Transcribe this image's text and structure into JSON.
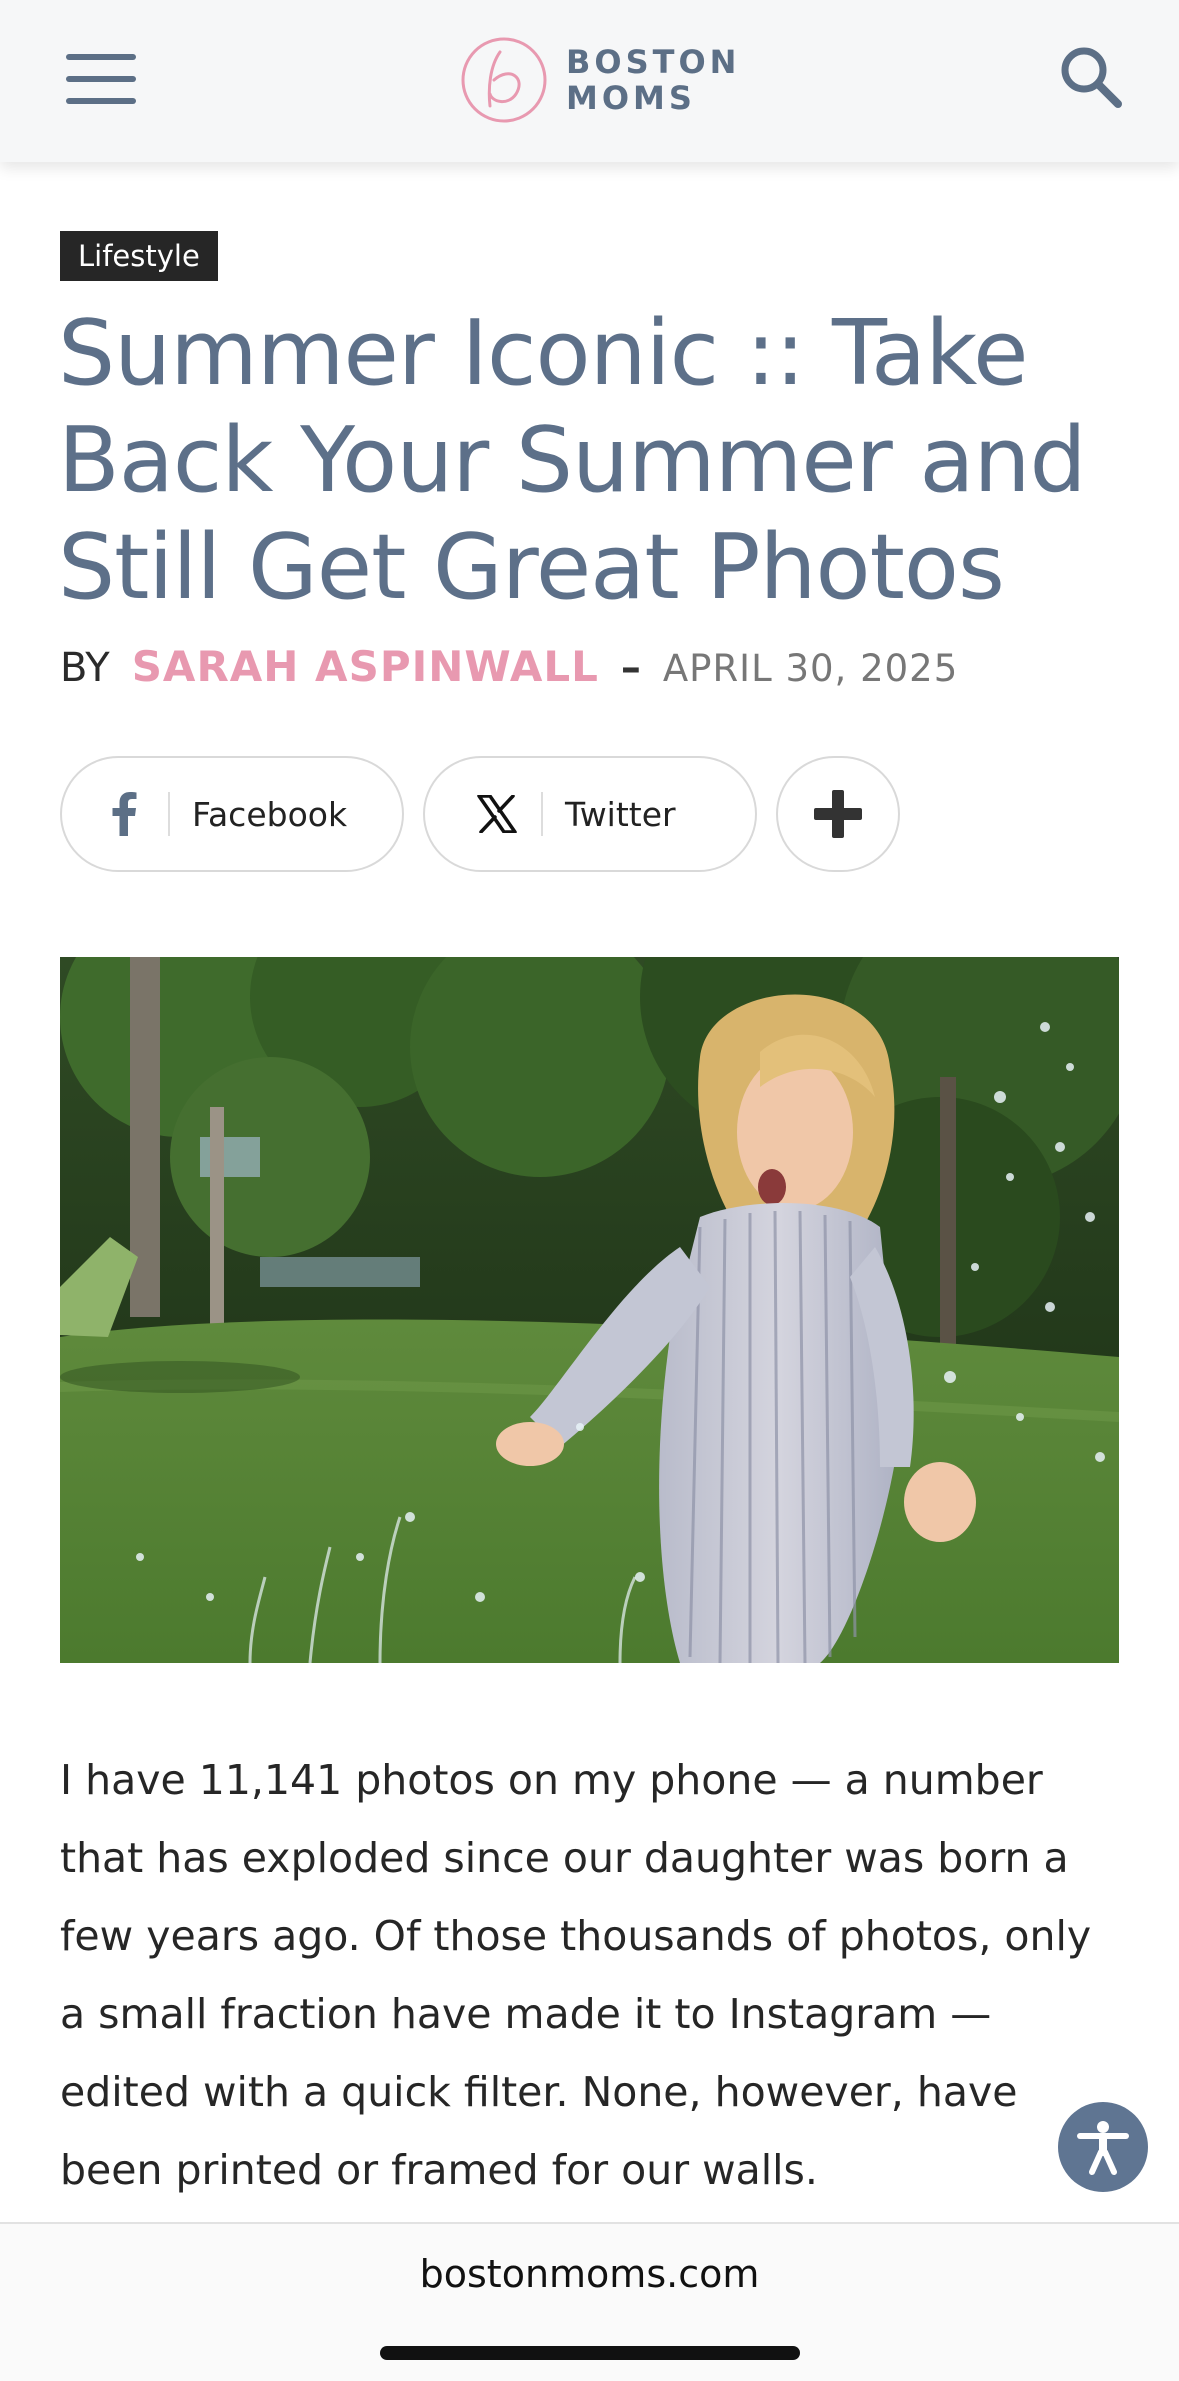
{
  "header": {
    "logo_line1": "BOSTON",
    "logo_line2": "MOMS",
    "menu_icon": "hamburger-menu-icon",
    "search_icon": "search-icon",
    "brand_color": "#5c6f86",
    "logo_accent_color": "#e899b0"
  },
  "article": {
    "category": "Lifestyle",
    "title": "Summer Iconic :: Take Back Your Summer and Still Get Great Photos",
    "byline_prefix": "BY",
    "author": "SARAH ASPINWALL",
    "separator": "–",
    "date": "APRIL 30, 2025",
    "share": {
      "facebook_label": "Facebook",
      "twitter_label": "Twitter",
      "facebook_icon": "facebook-icon",
      "twitter_icon": "x-icon",
      "more_icon": "plus-icon"
    },
    "hero_icon": "photo-girl-playing-in-sprinkler",
    "body": "I have 11,141 photos on my phone — a number that has exploded since our daughter was born a few years ago. Of those thousands of photos, only a small fraction have made it to Instagram — edited with a quick filter. None, however, have been printed or framed for our walls."
  },
  "accessibility": {
    "icon": "accessibility-icon",
    "color": "#5f7592"
  },
  "browser": {
    "url": "bostonmoms.com"
  }
}
